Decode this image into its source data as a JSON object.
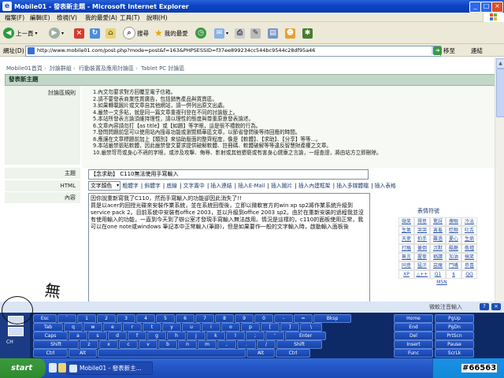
{
  "window": {
    "title": "Mobile01 - 發表新主題 - Microsoft Internet Explorer",
    "buttons": [
      "_",
      "□",
      "×"
    ]
  },
  "menu": [
    "檔案(F)",
    "編輯(E)",
    "檢視(V)",
    "我的最愛(A)",
    "工具(T)",
    "說明(H)"
  ],
  "toolbar": {
    "back": "上一頁",
    "search": "搜尋",
    "favorites": "我的最愛"
  },
  "address": {
    "label": "網址(D)",
    "url": "http://www.mobile01.com/post.php?mode=post&f=163&PHPSESSID=f37ee899234cc544bc9544c28df95a46",
    "go": "移至",
    "links": "連結"
  },
  "breadcrumb": [
    "Mobile01首頁",
    "討論群組",
    "行動裝置及應用討論區",
    "Tablet PC 討論區"
  ],
  "page_header": "發表新主題",
  "rules": {
    "label": "討論區規則",
    "items": [
      "1.內文勿要求對方回覆至電子信箱。",
      "2.請不要發表商業性質廣告，包括銷售產品與買賣區。",
      "3.如果轉載圖片或文章自其他網站，請一併列出原文出處。",
      "4.嚴禁一文多貼，就是同一篇文章重複刊登在不同的討論版上。",
      "5.本站所發表言論須維持理性，請以理性的態度與尊重原意發表論述。",
      "6.文章內容請勿打【as title】或【如題】等字眼，這是很不禮貌的行為。",
      "7.發問問題前您可以使用站內搜尋功能或瀏覽精華區文章，以節省發問後等待回應的時間。",
      "8.應讓在文章標題前加上【類別】來協助版面的整齊程度，像是【軟體】、【求助】、【分享】等等...。",
      "9.本站嚴禁張貼軟體，因此嚴禁發文要求提供破解軟體、註冊碼、軟體破解等等違反智慧財產權之文章。",
      "10.嚴禁苛苛或身心不適的字眼，或涉及攻擊、侮辱、影射或其他猥褻或有害身心健康之言論，一經查證，將由站方立即刪除。"
    ]
  },
  "subject": {
    "label": "主題",
    "value": "【念求助】 C110無法使用手寫輸入"
  },
  "html_toolbar": {
    "label": "HTML",
    "select": "文字顏色",
    "items": [
      "粗體字",
      "斜體字",
      "底線",
      "文字置中",
      "插入連結",
      "插入E-Mail",
      "插入圖片",
      "插入內建框架",
      "插入多媒體檔",
      "插入表格"
    ]
  },
  "content": {
    "label": "內容",
    "text": "買是以acer的回授光碟來安裝作業系統，並在系統回復後，立即以微軟官方的win xp sp2將作業系統升級到service pack 2。目前系統中安裝有office 2003，並以升級到office 2003 sp2。由於在重新安裝的過程我並沒有使用輸入的功能，一直到今天到了辦公室才發現手寫輸入無法啟用。情況是這樣的，c110的面板使用正常，我可以在one note或windows 筆記本中正常輸入(筆跡)，但是如果要作一般的文字輸入時，啟動輸入面板後",
    "first_line": "因你說重新寫我了C110，然而手寫輸入的功能卻因此消失了!!"
  },
  "emoticons": {
    "title": "表情符號",
    "cells": [
      "微笑",
      "得意",
      "驚訝",
      "傻眼",
      "冷淡",
      "生氣",
      "哭哭",
      "害羞",
      "眨眼",
      "吐舌",
      "天使",
      "拍手",
      "難過",
      "憂心",
      "生病",
      "打瞌",
      "暈倒",
      "沉默",
      "酷斃",
      "敬禮",
      "無言",
      "握拳",
      "稱讚",
      "加油",
      "搞笑",
      "同意",
      "猛汗",
      "惡魔",
      "鬥嘴",
      "恭喜"
    ],
    "row_nums": [
      "XP",
      "△++",
      "Q1",
      "$",
      "QQ"
    ],
    "more": "MSN"
  },
  "handwriting": "無法使用",
  "osk": {
    "brand": "微軟注音輸入",
    "row1": [
      "Esc",
      "`",
      "1",
      "2",
      "3",
      "4",
      "5",
      "6",
      "7",
      "8",
      "9",
      "0",
      "-",
      "=",
      "Bksp"
    ],
    "row2": [
      "Tab",
      "q",
      "w",
      "e",
      "r",
      "t",
      "y",
      "u",
      "i",
      "o",
      "p",
      "[",
      "]",
      "\\"
    ],
    "row3": [
      "Caps",
      "a",
      "s",
      "d",
      "f",
      "g",
      "h",
      "j",
      "k",
      "l",
      ";",
      "'",
      "Enter"
    ],
    "row4": [
      "Shift",
      "z",
      "x",
      "c",
      "v",
      "b",
      "n",
      "m",
      ",",
      ".",
      "/",
      "Shift"
    ],
    "row5": [
      "Ctrl",
      "Alt",
      "",
      "Alt",
      "Ctrl"
    ],
    "nav": [
      [
        "Home",
        "PgUp"
      ],
      [
        "End",
        "PgDn"
      ],
      [
        "Del",
        "PrtScn"
      ],
      [
        "Insert",
        "Pause"
      ],
      [
        "Func",
        "ScrLk"
      ]
    ],
    "left_label": "CH"
  },
  "taskbar": {
    "start": "start",
    "task": "Mobile01 - 發表新主..."
  },
  "stamp": "#66563"
}
